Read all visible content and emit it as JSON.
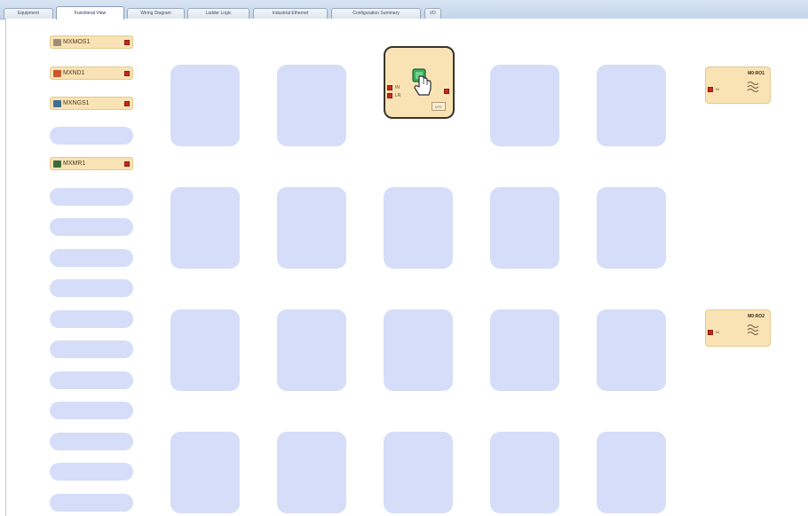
{
  "tabs": [
    {
      "label": "Equipment",
      "active": false
    },
    {
      "label": "Functional View",
      "active": true
    },
    {
      "label": "Wiring Diagram",
      "active": false
    },
    {
      "label": "Ladder Logic",
      "active": false
    },
    {
      "label": "Industrial Ethernet",
      "active": false
    },
    {
      "label": "Configuration Summary",
      "active": false
    },
    {
      "label": "I/O",
      "active": false
    }
  ],
  "input_devices": [
    {
      "label": "MXMOS1",
      "icon": "sensor-bracket-icon",
      "icon_color": "#9c8f78"
    },
    {
      "label": "MXND1",
      "icon": "estop-device-icon",
      "icon_color": "#c8582e"
    },
    {
      "label": "MXNGS1",
      "icon": "light-curtain-icon",
      "icon_color": "#3f6f8f"
    },
    {
      "label": "MXMR1",
      "icon": "safety-mat-icon",
      "icon_color": "#3d6b3a"
    }
  ],
  "logic_block": {
    "inputs": [
      "IN",
      "LR"
    ],
    "tag": "DT1",
    "icon": "hand-on-button-icon"
  },
  "output_devices": [
    {
      "title": "M0:RO1",
      "port_label": "IN",
      "icon": "relay-coil-icon"
    },
    {
      "title": "M0:RO2",
      "port_label": "IN",
      "icon": "relay-coil-icon"
    }
  ],
  "colors": {
    "slot": "#d5ddf8",
    "block": "#f9e3b5",
    "port": "#c8281e",
    "logic_button": "#3cae5c"
  }
}
